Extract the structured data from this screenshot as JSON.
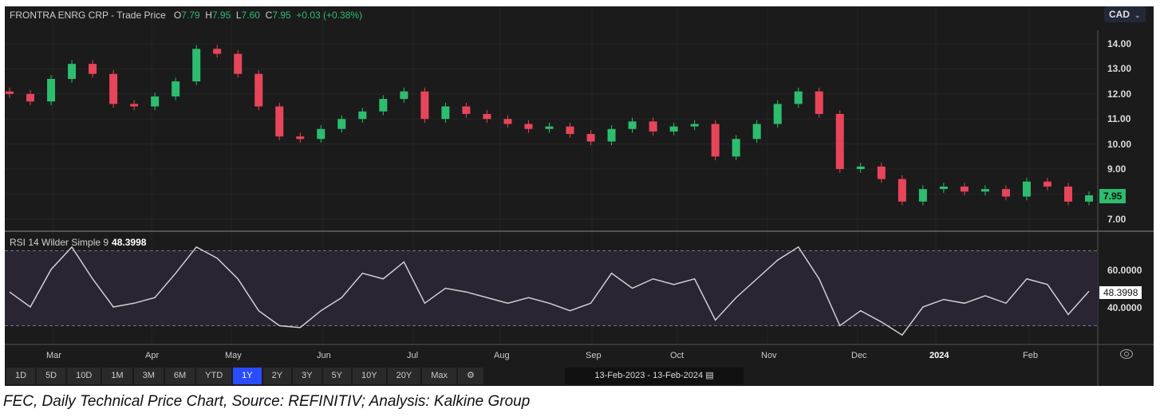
{
  "header": {
    "title": "FRONTRA ENRG CRP - Trade Price",
    "o_label": "O",
    "open": "7.79",
    "h_label": "H",
    "high": "7.95",
    "l_label": "L",
    "low": "7.60",
    "c_label": "C",
    "close": "7.95",
    "change": "+0.03 (+0.38%)"
  },
  "currency": "CAD",
  "price_badge": "7.95",
  "rsi_label": "RSI 14 Wilder Simple 9",
  "rsi_value": "48.3998",
  "range_buttons": [
    "1D",
    "5D",
    "10D",
    "1M",
    "3M",
    "6M",
    "YTD",
    "1Y",
    "2Y",
    "3Y",
    "5Y",
    "10Y",
    "20Y",
    "Max"
  ],
  "active_range": "1Y",
  "date_range": "13-Feb-2023  -  13-Feb-2024",
  "caption": "FEC, Daily Technical Price Chart, Source: REFINITIV; Analysis: Kalkine Group",
  "colors": {
    "up": "#2dbd6e",
    "down": "#e8455a",
    "rsi_line": "#d0d0d0",
    "active": "#2a4cff"
  },
  "chart_data": {
    "type": "candlestick",
    "title": "FRONTRA ENRG CRP - Trade Price",
    "x_tick_labels": [
      "Mar",
      "Apr",
      "May",
      "Jun",
      "Jul",
      "Aug",
      "Sep",
      "Oct",
      "Nov",
      "Dec",
      "2024",
      "Feb"
    ],
    "y_tick_labels": [
      "14.00",
      "13.00",
      "12.00",
      "11.00",
      "10.00",
      "9.00",
      "7.00"
    ],
    "ylim": [
      6.6,
      14.6
    ],
    "period": "13-Feb-2023 to 13-Feb-2024, weekly approximation",
    "closes": [
      12.0,
      11.7,
      12.6,
      13.2,
      12.8,
      11.6,
      11.5,
      11.9,
      12.5,
      13.8,
      13.6,
      12.8,
      11.5,
      10.3,
      10.2,
      10.6,
      11.0,
      11.3,
      11.8,
      12.1,
      11.0,
      11.5,
      11.2,
      11.0,
      10.8,
      10.6,
      10.7,
      10.4,
      10.1,
      10.6,
      10.9,
      10.5,
      10.7,
      10.8,
      9.5,
      10.2,
      10.8,
      11.6,
      12.1,
      11.2,
      9.0,
      9.1,
      8.6,
      7.7,
      8.2,
      8.3,
      8.1,
      8.2,
      7.9,
      8.5,
      8.3,
      7.7,
      7.95
    ],
    "rsi": {
      "title": "RSI 14 Wilder Simple 9",
      "y_tick_labels": [
        "60.0000",
        "40.0000"
      ],
      "ylim": [
        18,
        78
      ],
      "bands": [
        30,
        70
      ],
      "values": [
        48,
        40,
        60,
        72,
        55,
        40,
        42,
        45,
        58,
        72,
        66,
        55,
        38,
        30,
        29,
        38,
        45,
        58,
        55,
        64,
        42,
        50,
        48,
        45,
        42,
        45,
        42,
        38,
        42,
        58,
        50,
        55,
        52,
        55,
        33,
        45,
        55,
        65,
        72,
        55,
        30,
        38,
        32,
        25,
        40,
        44,
        42,
        46,
        42,
        55,
        52,
        36,
        48.4
      ]
    }
  }
}
